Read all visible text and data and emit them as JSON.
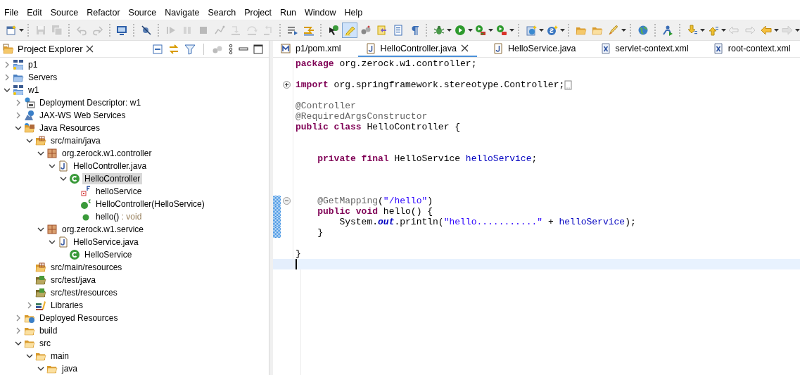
{
  "menu": [
    "File",
    "Edit",
    "Source",
    "Refactor",
    "Source",
    "Navigate",
    "Search",
    "Project",
    "Run",
    "Window",
    "Help"
  ],
  "toolbar": {
    "items": [
      {
        "kind": "button",
        "dropdown": true,
        "disabled": false,
        "pressed": false
      },
      {
        "kind": "separator"
      },
      {
        "kind": "button",
        "dropdown": false,
        "disabled": true,
        "pressed": false
      },
      {
        "kind": "button",
        "dropdown": false,
        "disabled": true,
        "pressed": false
      },
      {
        "kind": "separator"
      },
      {
        "kind": "button",
        "dropdown": false,
        "disabled": true,
        "pressed": false
      },
      {
        "kind": "button",
        "dropdown": false,
        "disabled": true,
        "pressed": false
      },
      {
        "kind": "separator"
      },
      {
        "kind": "button",
        "dropdown": false,
        "disabled": false,
        "pressed": false
      },
      {
        "kind": "separator"
      },
      {
        "kind": "button",
        "dropdown": false,
        "disabled": false,
        "pressed": false
      },
      {
        "kind": "separator"
      },
      {
        "kind": "button",
        "dropdown": false,
        "disabled": true,
        "pressed": false
      },
      {
        "kind": "button",
        "dropdown": false,
        "disabled": true,
        "pressed": false
      },
      {
        "kind": "button",
        "dropdown": false,
        "disabled": true,
        "pressed": false
      },
      {
        "kind": "button",
        "dropdown": false,
        "disabled": true,
        "pressed": false
      },
      {
        "kind": "button",
        "dropdown": false,
        "disabled": true,
        "pressed": false
      },
      {
        "kind": "button",
        "dropdown": false,
        "disabled": true,
        "pressed": false
      },
      {
        "kind": "button",
        "dropdown": false,
        "disabled": true,
        "pressed": false
      },
      {
        "kind": "separator"
      },
      {
        "kind": "button",
        "dropdown": false,
        "disabled": false,
        "pressed": false
      },
      {
        "kind": "button",
        "dropdown": false,
        "disabled": false,
        "pressed": false
      },
      {
        "kind": "separator"
      },
      {
        "kind": "button",
        "dropdown": false,
        "disabled": false,
        "pressed": false
      },
      {
        "kind": "button",
        "dropdown": false,
        "disabled": false,
        "pressed": true
      },
      {
        "kind": "button",
        "dropdown": false,
        "disabled": false,
        "pressed": false
      },
      {
        "kind": "button",
        "dropdown": false,
        "disabled": false,
        "pressed": false
      },
      {
        "kind": "button",
        "dropdown": false,
        "disabled": false,
        "pressed": false
      },
      {
        "kind": "button",
        "dropdown": false,
        "disabled": false,
        "pressed": false
      },
      {
        "kind": "separator"
      },
      {
        "kind": "button",
        "dropdown": true,
        "disabled": false,
        "pressed": false
      },
      {
        "kind": "button",
        "dropdown": true,
        "disabled": false,
        "pressed": false
      },
      {
        "kind": "button",
        "dropdown": true,
        "disabled": false,
        "pressed": false
      },
      {
        "kind": "button",
        "dropdown": true,
        "disabled": false,
        "pressed": false
      },
      {
        "kind": "separator"
      },
      {
        "kind": "button",
        "dropdown": true,
        "disabled": false,
        "pressed": false
      },
      {
        "kind": "button",
        "dropdown": true,
        "disabled": false,
        "pressed": false
      },
      {
        "kind": "separator"
      },
      {
        "kind": "button",
        "dropdown": false,
        "disabled": false,
        "pressed": false
      },
      {
        "kind": "button",
        "dropdown": false,
        "disabled": false,
        "pressed": false
      },
      {
        "kind": "button",
        "dropdown": true,
        "disabled": false,
        "pressed": false
      },
      {
        "kind": "separator"
      },
      {
        "kind": "button",
        "dropdown": false,
        "disabled": false,
        "pressed": false
      },
      {
        "kind": "separator"
      },
      {
        "kind": "button",
        "dropdown": false,
        "disabled": false,
        "pressed": false
      },
      {
        "kind": "separator"
      },
      {
        "kind": "button",
        "dropdown": true,
        "disabled": false,
        "pressed": false
      },
      {
        "kind": "button",
        "dropdown": true,
        "disabled": false,
        "pressed": false
      },
      {
        "kind": "button",
        "dropdown": false,
        "disabled": true,
        "pressed": false
      },
      {
        "kind": "button",
        "dropdown": false,
        "disabled": true,
        "pressed": false
      },
      {
        "kind": "button",
        "dropdown": true,
        "disabled": false,
        "pressed": false
      },
      {
        "kind": "button",
        "dropdown": true,
        "disabled": true,
        "pressed": false
      }
    ]
  },
  "explorer": {
    "title": "Project Explorer",
    "selected": true,
    "tree": [
      {
        "label": "p1",
        "kind": "maven-project",
        "expanded": false,
        "selected": false
      },
      {
        "label": "Servers",
        "kind": "servers",
        "expanded": false,
        "selected": false
      },
      {
        "label": "w1",
        "kind": "maven-project",
        "expanded": true,
        "selected": false,
        "children": [
          {
            "label": "Deployment Descriptor: w1",
            "kind": "descriptor",
            "expanded": false,
            "selected": false
          },
          {
            "label": "JAX-WS Web Services",
            "kind": "webservices",
            "expanded": false,
            "selected": false
          },
          {
            "label": "Java Resources",
            "kind": "java-resources",
            "expanded": true,
            "selected": false,
            "children": [
              {
                "label": "src/main/java",
                "kind": "source-folder",
                "expanded": true,
                "selected": false,
                "children": [
                  {
                    "label": "org.zerock.w1.controller",
                    "kind": "package",
                    "expanded": true,
                    "selected": false,
                    "children": [
                      {
                        "label": "HelloController.java",
                        "kind": "java-file",
                        "expanded": true,
                        "selected": false,
                        "children": [
                          {
                            "label": "HelloController",
                            "kind": "class",
                            "expanded": true,
                            "selected": true,
                            "children": [
                              {
                                "label": "helloService",
                                "kind": "field",
                                "selected": false
                              },
                              {
                                "label": "HelloController(HelloService)",
                                "kind": "constructor",
                                "selected": false
                              },
                              {
                                "label": "hello()",
                                "detail": " : void",
                                "kind": "method",
                                "selected": false
                              }
                            ]
                          }
                        ]
                      }
                    ]
                  },
                  {
                    "label": "org.zerock.w1.service",
                    "kind": "package",
                    "expanded": true,
                    "selected": false,
                    "children": [
                      {
                        "label": "HelloService.java",
                        "kind": "java-file",
                        "expanded": true,
                        "selected": false,
                        "children": [
                          {
                            "label": "HelloService",
                            "kind": "class",
                            "selected": false
                          }
                        ]
                      }
                    ]
                  }
                ]
              },
              {
                "label": "src/main/resources",
                "kind": "source-folder",
                "selected": false
              },
              {
                "label": "src/test/java",
                "kind": "test-source-folder",
                "selected": false
              },
              {
                "label": "src/test/resources",
                "kind": "test-source-folder",
                "selected": false
              },
              {
                "label": "Libraries",
                "kind": "libraries",
                "expanded": false,
                "selected": false
              }
            ]
          },
          {
            "label": "Deployed Resources",
            "kind": "deployed-resources",
            "expanded": false,
            "selected": false
          },
          {
            "label": "build",
            "kind": "folder",
            "expanded": false,
            "selected": false
          },
          {
            "label": "src",
            "kind": "folder",
            "expanded": true,
            "selected": false,
            "children": [
              {
                "label": "main",
                "kind": "folder",
                "expanded": true,
                "selected": false,
                "children": [
                  {
                    "label": "java",
                    "kind": "folder",
                    "expanded": true,
                    "selected": false
                  }
                ]
              }
            ]
          }
        ]
      }
    ]
  },
  "editor": {
    "tabs": [
      {
        "label": "p1/pom.xml",
        "kind": "maven",
        "selected": false
      },
      {
        "label": "HelloController.java",
        "kind": "java",
        "selected": true
      },
      {
        "label": "HelloService.java",
        "kind": "java",
        "selected": false
      },
      {
        "label": "servlet-context.xml",
        "kind": "xml",
        "selected": false
      },
      {
        "label": "root-context.xml",
        "kind": "xml",
        "selected": false
      }
    ],
    "lines": [
      {
        "changed": false,
        "current": false,
        "tokens": [
          {
            "kind": "keyword",
            "text": "package"
          },
          {
            "kind": "plain",
            "text": " org.zerock.w1.controller;"
          }
        ]
      },
      {
        "changed": false,
        "current": false
      },
      {
        "changed": false,
        "current": false,
        "folded": true,
        "tokens": [
          {
            "kind": "keyword",
            "text": "import"
          },
          {
            "kind": "plain",
            "text": " org.springframework.stereotype.Controller;"
          }
        ]
      },
      {
        "changed": false,
        "current": false
      },
      {
        "changed": false,
        "current": false,
        "tokens": [
          {
            "kind": "annotation",
            "text": "@Controller"
          }
        ]
      },
      {
        "changed": false,
        "current": false,
        "tokens": [
          {
            "kind": "annotation",
            "text": "@RequiredArgsConstructor"
          }
        ]
      },
      {
        "changed": false,
        "current": false,
        "tokens": [
          {
            "kind": "keyword",
            "text": "public class"
          },
          {
            "kind": "plain",
            "text": " HelloController {"
          }
        ]
      },
      {
        "changed": false,
        "current": false
      },
      {
        "changed": false,
        "current": false
      },
      {
        "changed": false,
        "current": false,
        "tokens": [
          {
            "kind": "keyword",
            "text": "    private final"
          },
          {
            "kind": "plain",
            "text": " HelloService "
          },
          {
            "kind": "field",
            "text": "helloService"
          },
          {
            "kind": "plain",
            "text": ";"
          }
        ]
      },
      {
        "changed": false,
        "current": false
      },
      {
        "changed": false,
        "current": false
      },
      {
        "changed": false,
        "current": false
      },
      {
        "changed": true,
        "current": false,
        "folded": false,
        "tokens": [
          {
            "kind": "annotation",
            "text": "    @GetMapping"
          },
          {
            "kind": "plain",
            "text": "("
          },
          {
            "kind": "string",
            "text": "\"/hello\""
          },
          {
            "kind": "plain",
            "text": ")"
          }
        ]
      },
      {
        "changed": true,
        "current": false,
        "tokens": [
          {
            "kind": "keyword",
            "text": "    public void"
          },
          {
            "kind": "plain",
            "text": " hello() {"
          }
        ]
      },
      {
        "changed": true,
        "current": false,
        "tokens": [
          {
            "kind": "plain",
            "text": "        System."
          },
          {
            "kind": "static",
            "text": "out"
          },
          {
            "kind": "plain",
            "text": ".println("
          },
          {
            "kind": "string",
            "text": "\"hello...........\""
          },
          {
            "kind": "plain",
            "text": " + "
          },
          {
            "kind": "field",
            "text": "helloService"
          },
          {
            "kind": "plain",
            "text": ");"
          }
        ]
      },
      {
        "changed": true,
        "current": false,
        "tokens": [
          {
            "kind": "plain",
            "text": "    }"
          }
        ]
      },
      {
        "changed": false,
        "current": false
      },
      {
        "changed": false,
        "current": false,
        "tokens": [
          {
            "kind": "plain",
            "text": "}"
          }
        ]
      },
      {
        "changed": false,
        "current": true
      }
    ]
  }
}
